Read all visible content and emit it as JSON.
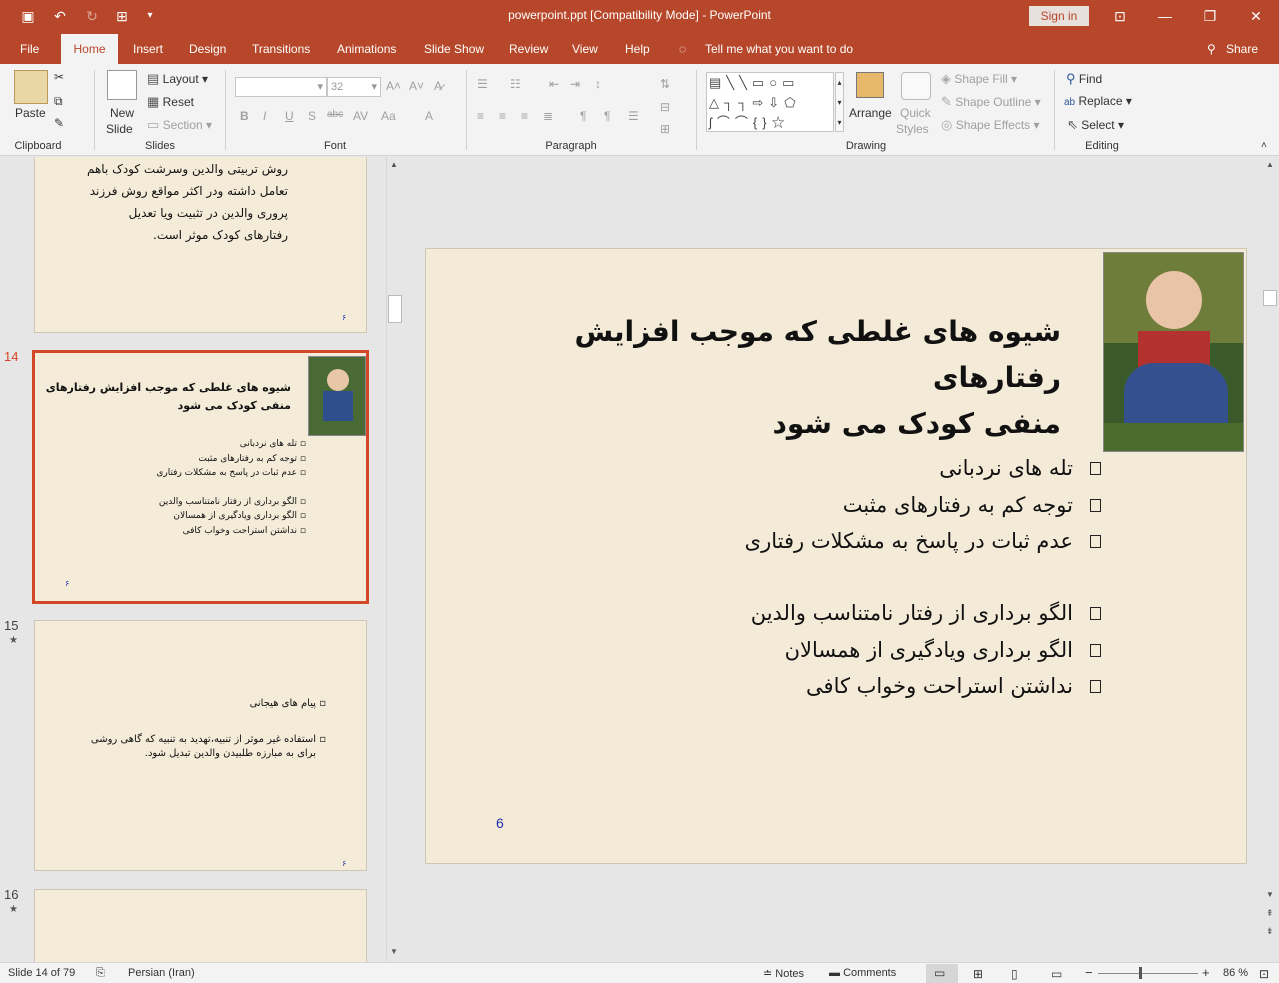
{
  "window": {
    "title": "powerpoint.ppt [Compatibility Mode]  -  PowerPoint",
    "signin": "Sign in"
  },
  "colors": {
    "accent": "#b7472a",
    "active_thumb": "#d24726",
    "slide_bg": "#f3ead7",
    "slide_number": "#2030b0"
  },
  "tabs": [
    {
      "label": "File"
    },
    {
      "label": "Home"
    },
    {
      "label": "Insert"
    },
    {
      "label": "Design"
    },
    {
      "label": "Transitions"
    },
    {
      "label": "Animations"
    },
    {
      "label": "Slide Show"
    },
    {
      "label": "Review"
    },
    {
      "label": "View"
    },
    {
      "label": "Help"
    }
  ],
  "tellme": "Tell me what you want to do",
  "share": "Share",
  "ribbon": {
    "clipboard": {
      "paste": "Paste",
      "label": "Clipboard"
    },
    "slides": {
      "new_slide_1": "New",
      "new_slide_2": "Slide",
      "layout": "Layout",
      "reset": "Reset",
      "section": "Section",
      "label": "Slides"
    },
    "font": {
      "size": "32",
      "label": "Font"
    },
    "paragraph": {
      "label": "Paragraph"
    },
    "drawing": {
      "arrange": "Arrange",
      "quick_1": "Quick",
      "quick_2": "Styles",
      "fill": "Shape Fill",
      "outline": "Shape Outline",
      "effects": "Shape Effects",
      "label": "Drawing"
    },
    "editing": {
      "find": "Find",
      "replace": "Replace",
      "select": "Select",
      "label": "Editing"
    }
  },
  "thumbnails": {
    "prev": {
      "lines": [
        "روش تربیتی والدین وسرشت کودک باهم",
        "تعامل داشته ودر اکثر مواقع روش فرزند",
        "پروری والدین در تثبیت ویا تعدیل",
        "رفتارهای کودک موثر است."
      ],
      "num": "۶"
    },
    "s14": {
      "num": "14",
      "title_1": "شیوه های غلطی که موجب افزایش رفتارهای",
      "title_2": "منفی کودک می شود",
      "bullets": [
        "تله های نردبانی",
        "توجه کم به رفتارهای مثبت",
        "عدم ثبات در پاسخ به مشکلات رفتاری",
        "الگو برداری از رفتار نامتناسب والدین",
        "الگو برداری ویادگیری از همسالان",
        "نداشتن استراحت وخواب کافی"
      ],
      "pagenum": "۶"
    },
    "s15": {
      "num": "15",
      "b1": "پیام های هیجانی",
      "b2a": "استفاده غیر موثر از تنبیه،تهدید به تنبیه که گاهی روشی",
      "b2b": "برای به مبارزه طلبیدن والدین تبدیل شود.",
      "pagenum": "۶"
    },
    "s16": {
      "num": "16"
    }
  },
  "slide": {
    "title_1": "شیوه های غلطی که موجب افزایش رفتارهای",
    "title_2": "منفی کودک می شود",
    "bullets": [
      "تله های نردبانی",
      "توجه کم به رفتارهای مثبت",
      "عدم ثبات در پاسخ به مشکلات رفتاری",
      "الگو برداری از رفتار نامتناسب والدین",
      "الگو برداری ویادگیری از همسالان",
      "نداشتن استراحت وخواب کافی"
    ],
    "number": "6"
  },
  "status": {
    "slide": "Slide 14 of 79",
    "language": "Persian (Iran)",
    "notes": "Notes",
    "comments": "Comments",
    "zoom": "86 %"
  }
}
